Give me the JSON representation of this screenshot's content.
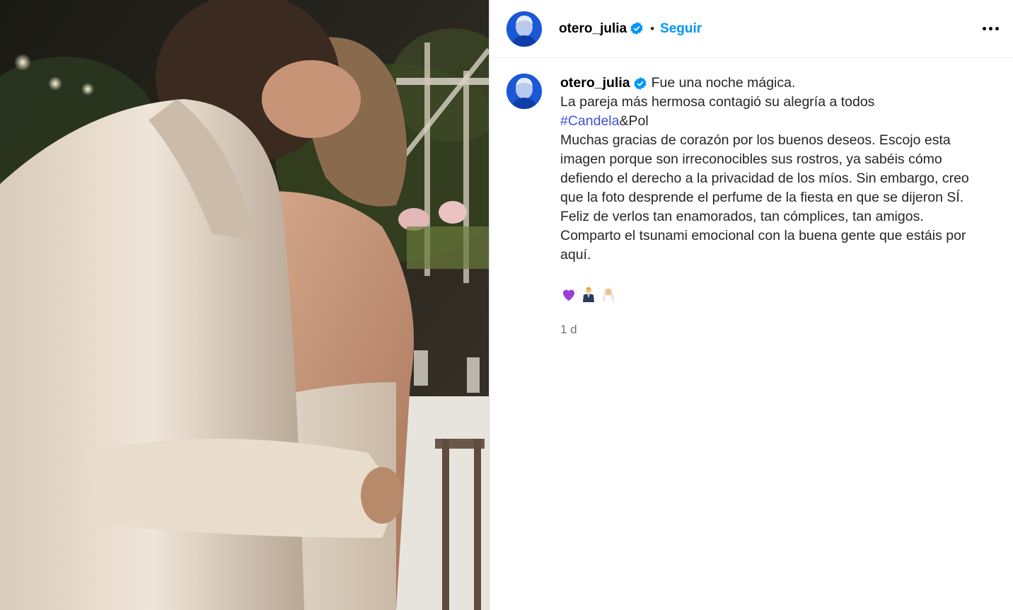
{
  "post": {
    "username": "otero_julia",
    "follow_label": "Seguir",
    "separator": "•",
    "caption": {
      "username": "otero_julia",
      "lines": [
        "Fue una noche mágica.",
        "La pareja más hermosa contagió su alegría a todos",
        "Muchas gracias de corazón por los buenos deseos. Escojo esta imagen porque son irreconocibles sus rostros, ya sabéis cómo defiendo el derecho a la privacidad de los míos. Sin embargo, creo que la foto desprende el perfume de la fiesta en que se dijeron SÍ.",
        "Feliz de verlos tan enamorados, tan cómplices, tan amigos. Comparto el tsunami emocional con la buena gente que estáis por aquí."
      ],
      "hashtag": "#Candela",
      "hashtag_suffix": "&Pol"
    },
    "emojis": [
      "purple-heart",
      "man-in-tuxedo",
      "woman-with-veil"
    ],
    "timestamp": "1 d"
  },
  "colors": {
    "link_blue": "#0095f6",
    "hashtag": "#3f51d6",
    "verified": "#0095f6",
    "muted": "#737373",
    "avatar_bg": "#1a58d6"
  }
}
